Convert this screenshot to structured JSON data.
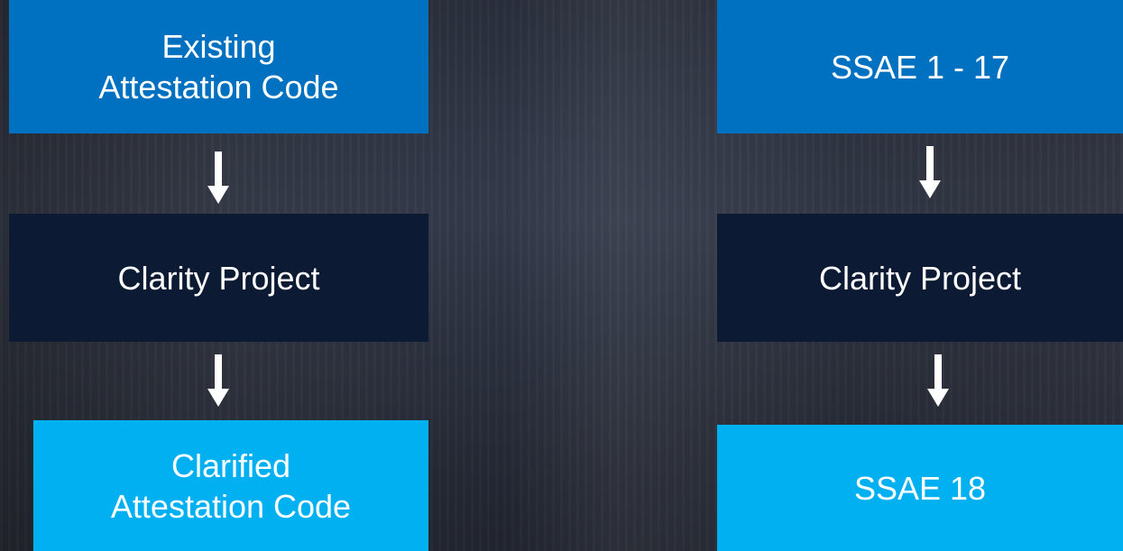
{
  "left_flow": {
    "top_box": "Existing\nAttestation Code",
    "middle_box": "Clarity Project",
    "bottom_box": "Clarified\nAttestation Code"
  },
  "right_flow": {
    "top_box": "SSAE 1 - 17",
    "middle_box": "Clarity Project",
    "bottom_box": "SSAE 18"
  },
  "colors": {
    "top_box": "#0070c0",
    "middle_box": "#0c1a33",
    "bottom_box": "#00b0f0",
    "arrow": "#ffffff"
  },
  "icons": {
    "connector": "arrow-down-icon"
  }
}
